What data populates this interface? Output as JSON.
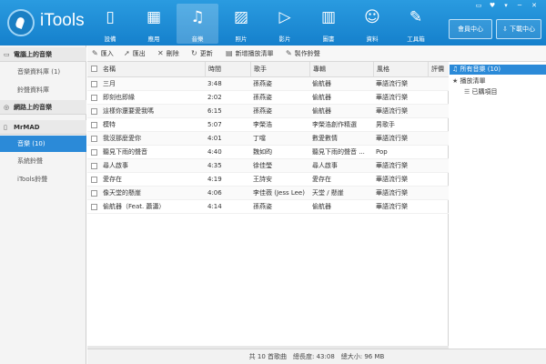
{
  "app": {
    "logo_text": "iTools"
  },
  "nav": [
    {
      "label": "設備",
      "icon": "phone-icon",
      "glyph": "▯"
    },
    {
      "label": "應用",
      "icon": "apps-icon",
      "glyph": "▦"
    },
    {
      "label": "音樂",
      "icon": "music-icon",
      "glyph": "♫",
      "active": true
    },
    {
      "label": "照片",
      "icon": "photo-icon",
      "glyph": "▨"
    },
    {
      "label": "影片",
      "icon": "video-icon",
      "glyph": "▷"
    },
    {
      "label": "圖書",
      "icon": "book-icon",
      "glyph": "▥"
    },
    {
      "label": "資料",
      "icon": "person-icon",
      "glyph": "☺"
    },
    {
      "label": "工具箱",
      "icon": "wrench-icon",
      "glyph": "✎"
    }
  ],
  "top_buttons": {
    "member_center": "會員中心",
    "download_center": "下載中心"
  },
  "window_controls": [
    "▭",
    "♥",
    "▾",
    "─",
    "✕"
  ],
  "sidebar": {
    "sections": [
      {
        "title": "電腦上的音樂",
        "items": [
          "音樂資料庫 (1)",
          "鈴聲資料庫"
        ]
      },
      {
        "title": "網路上的音樂",
        "items": []
      },
      {
        "title": "MrMAD",
        "items": [
          "音樂 (10)",
          "系統鈴聲",
          "iTools鈴聲"
        ]
      }
    ]
  },
  "toolbar": {
    "import": "匯入",
    "export": "匯出",
    "delete": "刪除",
    "refresh": "更新",
    "new_playlist": "新增播放清單",
    "make_ringtone": "製作鈴聲"
  },
  "table": {
    "columns": [
      "名稱",
      "時間",
      "歌手",
      "專輯",
      "風格",
      "評價"
    ],
    "rows": [
      [
        "三月",
        "3:48",
        "孫燕姿",
        "偷航器",
        "華語流行樂"
      ],
      [
        "即刻也即緣",
        "2:02",
        "孫燕姿",
        "偷航器",
        "華語流行樂"
      ],
      [
        "這樣你還要愛我嗎",
        "6:15",
        "孫燕姿",
        "偷航器",
        "華語流行樂"
      ],
      [
        "模特",
        "5:07",
        "李榮浩",
        "李榮浩創作精選",
        "男歌手"
      ],
      [
        "我沒那麼愛你",
        "4:01",
        "丁噹",
        "數愛數情",
        "華語流行樂"
      ],
      [
        "聽見下雨的聲音",
        "4:40",
        "魏如昀",
        "聽見下雨的聲音 ...",
        "Pop"
      ],
      [
        "尋人啟事",
        "4:35",
        "徐佳瑩",
        "尋人啟事",
        "華語流行樂"
      ],
      [
        "愛存在",
        "4:19",
        "王詩安",
        "愛存在",
        "華語流行樂"
      ],
      [
        "像天堂的懸崖",
        "4:06",
        "李佳薇 (Jess Lee)",
        "天堂 / 懸崖",
        "華語流行樂"
      ],
      [
        "偷航器（Feat. 蕭瀟）",
        "4:14",
        "孫燕姿",
        "偷航器",
        "華語流行樂"
      ]
    ]
  },
  "right_panel": {
    "all_music": "所有音樂 (10)",
    "playlists": "播放清單",
    "purchased": "已購項目"
  },
  "status": {
    "text": "共 10 首歌曲　總長度: 43:08　總大小: 96 MB"
  },
  "colors": {
    "topbar": "#1e8fd8",
    "accent": "#2b8ad8"
  }
}
